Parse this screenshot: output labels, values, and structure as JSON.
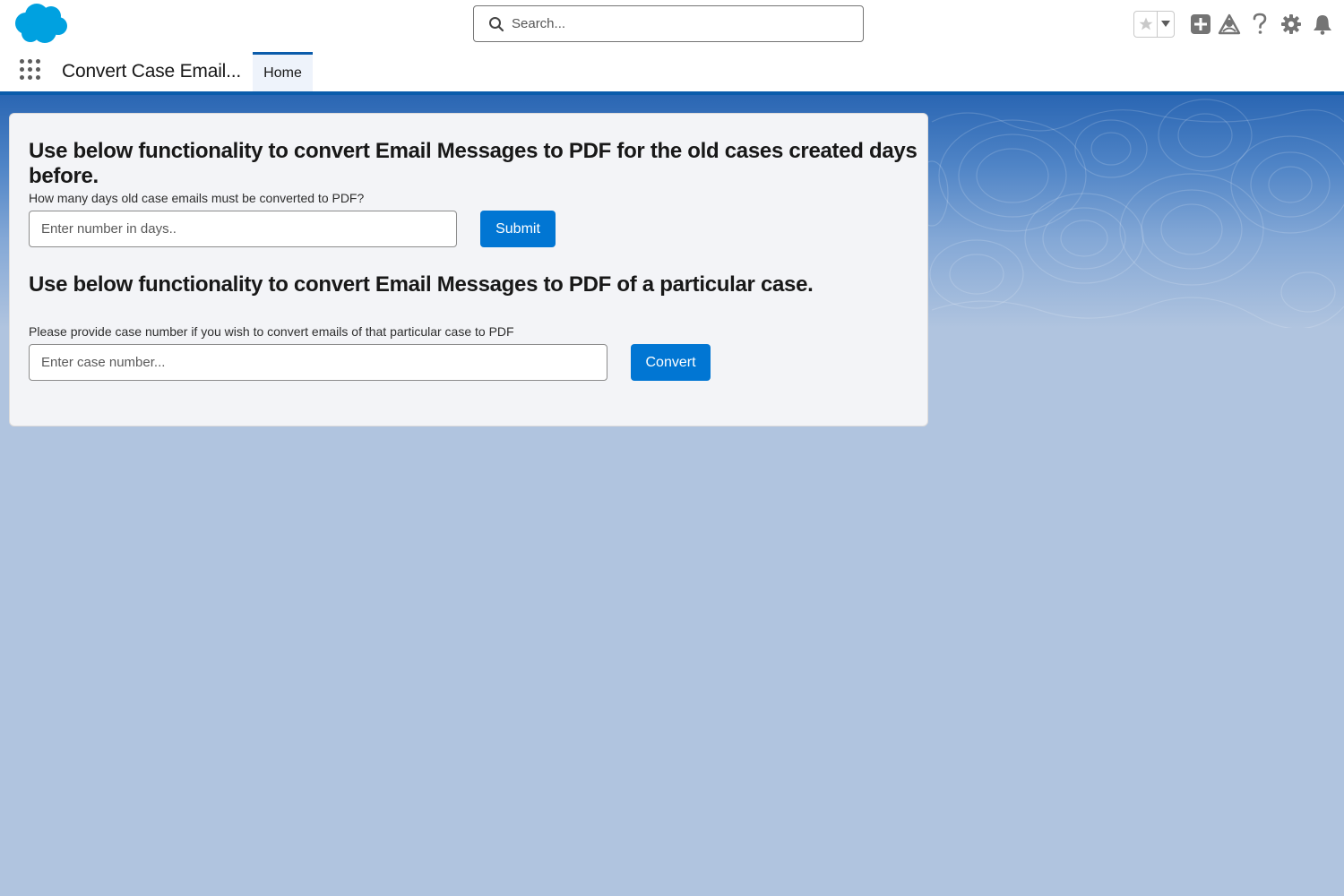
{
  "header": {
    "search_placeholder": "Search...",
    "icons": [
      "salesforce-cloud-logo",
      "favorites-star-icon",
      "chevron-down-icon",
      "global-create-icon",
      "trailhead-icon",
      "help-icon",
      "setup-gear-icon",
      "notifications-bell-icon"
    ]
  },
  "nav": {
    "app_name": "Convert Case Email...",
    "tabs": [
      {
        "label": "Home",
        "active": true
      }
    ]
  },
  "card": {
    "days_section": {
      "title": "Use below functionality to convert Email Messages to PDF for the old cases created days before.",
      "label": "How many days old case emails must be converted to PDF?",
      "placeholder": "Enter number in days..",
      "value": "",
      "button_label": "Submit"
    },
    "case_section": {
      "title": "Use below functionality to convert Email Messages to PDF of a particular case.",
      "label": "Please provide case number if you wish to convert emails of that particular case to PDF",
      "placeholder": "Enter case number...",
      "value": "",
      "button_label": "Convert"
    }
  },
  "colors": {
    "brand": "#0176d3",
    "nav_accent": "#0b5cab",
    "logo": "#00a1e0",
    "page_background": "#b0c4df"
  }
}
